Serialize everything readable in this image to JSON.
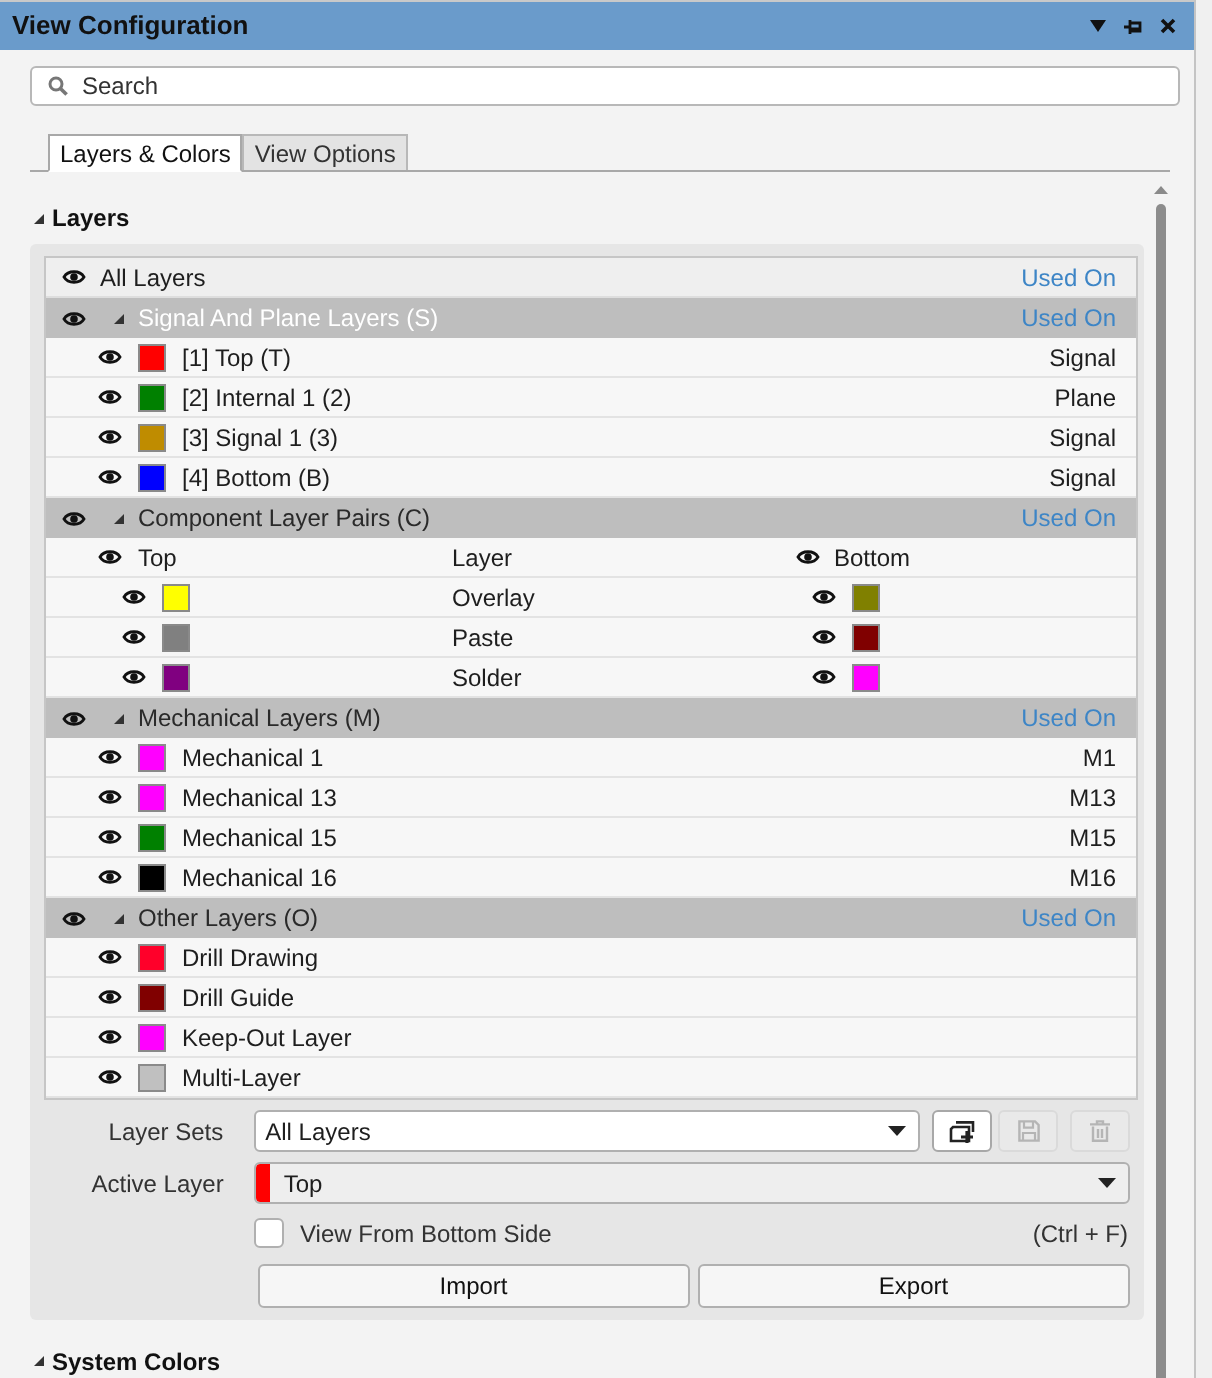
{
  "window": {
    "title": "View Configuration"
  },
  "search": {
    "placeholder": "Search"
  },
  "tabs": [
    {
      "label": "Layers & Colors",
      "selected": true
    },
    {
      "label": "View Options",
      "selected": false
    }
  ],
  "layers": {
    "title": "Layers",
    "expanded": true,
    "all_layers": {
      "label": "All Layers",
      "status": "Used On"
    },
    "groups": [
      {
        "kind": "layers",
        "title": "Signal And Plane Layers (S)",
        "status": "Used On",
        "selected": true,
        "expanded": true,
        "children": [
          {
            "label": "[1] Top (T)",
            "color": "#ff0000",
            "type": "Signal"
          },
          {
            "label": "[2] Internal 1 (2)",
            "color": "#008000",
            "type": "Plane"
          },
          {
            "label": "[3] Signal 1 (3)",
            "color": "#bf8c00",
            "type": "Signal"
          },
          {
            "label": "[4] Bottom (B)",
            "color": "#0000ff",
            "type": "Signal"
          }
        ]
      },
      {
        "kind": "pairs",
        "title": "Component Layer Pairs (C)",
        "status": "Used On",
        "selected": false,
        "expanded": true,
        "columns": [
          "Top",
          "Layer",
          "Bottom"
        ],
        "children": [
          {
            "label": "Overlay",
            "top": {
              "color": "#ffff00"
            },
            "bottom": {
              "color": "#808000"
            }
          },
          {
            "label": "Paste",
            "top": {
              "color": "#808080"
            },
            "bottom": {
              "color": "#800000"
            }
          },
          {
            "label": "Solder",
            "top": {
              "color": "#800080"
            },
            "bottom": {
              "color": "#ff00ff"
            }
          }
        ]
      },
      {
        "kind": "layers",
        "title": "Mechanical Layers (M)",
        "status": "Used On",
        "selected": false,
        "expanded": true,
        "children": [
          {
            "label": "Mechanical 1",
            "color": "#ff00ff",
            "type": "M1"
          },
          {
            "label": "Mechanical 13",
            "color": "#ff00ff",
            "type": "M13"
          },
          {
            "label": "Mechanical 15",
            "color": "#008000",
            "type": "M15"
          },
          {
            "label": "Mechanical 16",
            "color": "#000000",
            "type": "M16"
          }
        ]
      },
      {
        "kind": "layers",
        "title": "Other Layers (O)",
        "status": "Used On",
        "selected": false,
        "expanded": true,
        "children": [
          {
            "label": "Drill Drawing",
            "color": "#ff002a"
          },
          {
            "label": "Drill Guide",
            "color": "#800000"
          },
          {
            "label": "Keep-Out Layer",
            "color": "#ff00ff"
          },
          {
            "label": "Multi-Layer",
            "color": "#c0c0c0"
          }
        ]
      }
    ]
  },
  "layer_sets": {
    "label": "Layer Sets",
    "value": "All Layers",
    "buttons": [
      {
        "kind": "add",
        "disabled": false
      },
      {
        "kind": "save",
        "disabled": true
      },
      {
        "kind": "delete",
        "disabled": true
      }
    ]
  },
  "active_layer": {
    "label": "Active Layer",
    "value": "Top",
    "color": "#ff0000"
  },
  "view_from_bottom": {
    "label": "View From Bottom Side",
    "checked": false,
    "shortcut": "(Ctrl + F)"
  },
  "buttons": [
    "Import",
    "Export"
  ],
  "system_colors": {
    "title": "System Colors",
    "expanded": true
  }
}
